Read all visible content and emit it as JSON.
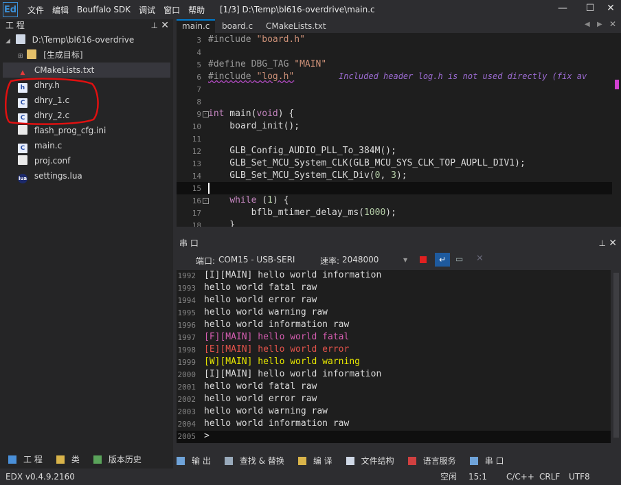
{
  "app": {
    "logo_text": "Ed",
    "menu": [
      "文件",
      "编辑",
      "Bouffalo SDK",
      "调试",
      "窗口",
      "帮助"
    ],
    "window_title": "[1/3] D:\\Temp\\bl616-overdrive\\main.c",
    "controls": {
      "minimize": "—",
      "maximize": "☐",
      "close": "✕"
    }
  },
  "project_panel": {
    "title": "工 程",
    "pin": "ꟷ",
    "close": "✕",
    "root": "D:\\Temp\\bl616-overdrive",
    "build_target": "[生成目标]",
    "files": [
      {
        "name": "CMakeLists.txt",
        "icon": "cmake-icon",
        "badge": "▲"
      },
      {
        "name": "dhry.h",
        "icon": "header-file-icon",
        "badge": "h"
      },
      {
        "name": "dhry_1.c",
        "icon": "c-file-icon",
        "badge": "C"
      },
      {
        "name": "dhry_2.c",
        "icon": "c-file-icon",
        "badge": "C"
      },
      {
        "name": "flash_prog_cfg.ini",
        "icon": "ini-file-icon",
        "badge": ""
      },
      {
        "name": "main.c",
        "icon": "c-file-icon",
        "badge": "C"
      },
      {
        "name": "proj.conf",
        "icon": "conf-file-icon",
        "badge": ""
      },
      {
        "name": "settings.lua",
        "icon": "lua-file-icon",
        "badge": "lua"
      }
    ],
    "bottom_tabs": [
      "工 程",
      "类",
      "版本历史"
    ]
  },
  "editor": {
    "tabs": [
      "main.c",
      "board.c",
      "CMakeLists.txt"
    ],
    "line_numbers": [
      "3",
      "4",
      "5",
      "6",
      "7",
      "8",
      "9",
      "10",
      "11",
      "12",
      "13",
      "14",
      "15",
      "16",
      "17",
      "18"
    ],
    "inline_hint": "Included header log.h is not used directly (fix av"
  },
  "serial": {
    "title": "串 口",
    "port_label": "端口:",
    "port_value": "COM15 - USB-SERI",
    "baud_label": "速率:",
    "baud_value": "2048000",
    "line_numbers": [
      "1992",
      "1993",
      "1994",
      "1995",
      "1996",
      "1997",
      "1998",
      "1999",
      "2000",
      "2001",
      "2002",
      "2003",
      "2004",
      "2005"
    ],
    "lines": [
      "[I][MAIN] hello world information",
      "hello world fatal raw",
      "hello world error raw",
      "hello world warning raw",
      "hello world information raw",
      "[F][MAIN] hello world fatal",
      "[E][MAIN] hello world error",
      "[W][MAIN] hello world warning",
      "[I][MAIN] hello world information",
      "hello world fatal raw",
      "hello world error raw",
      "hello world warning raw",
      "hello world information raw",
      ">"
    ],
    "line_colors": [
      "#dcdcdc",
      "#dcdcdc",
      "#dcdcdc",
      "#dcdcdc",
      "#dcdcdc",
      "#d65db1",
      "#e5534b",
      "#e6e600",
      "#dcdcdc",
      "#dcdcdc",
      "#dcdcdc",
      "#dcdcdc",
      "#dcdcdc",
      "#dcdcdc"
    ]
  },
  "bottom_tabs": [
    "输 出",
    "查找 & 替换",
    "编 译",
    "文件结构",
    "语言服务",
    "串 口"
  ],
  "status": {
    "version": "EDX v0.4.9.2160",
    "mode": "空闲",
    "position": "15:1",
    "language": "C/C++",
    "eol": "CRLF",
    "encoding": "UTF8"
  },
  "colors": {
    "accent": "#007acc",
    "annotation": "#e01010"
  }
}
